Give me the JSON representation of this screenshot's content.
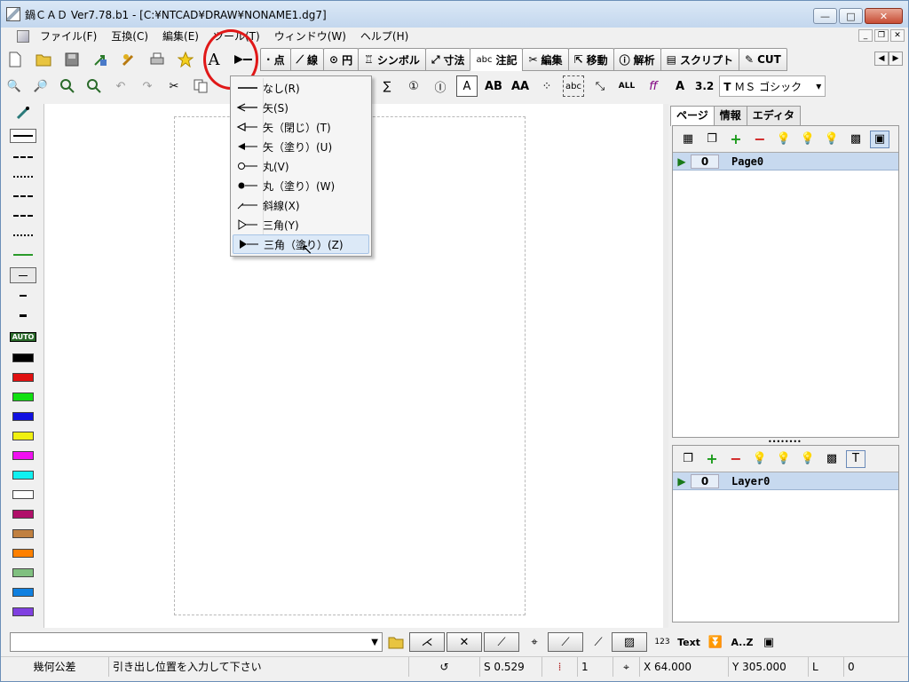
{
  "window": {
    "title": "鍋ＣＡＤ Ver7.78.b1 - [C:¥NTCAD¥DRAW¥NONAME1.dg7]",
    "minimize": "—",
    "maximize": "□",
    "close": "✕",
    "mdi_min": "_",
    "mdi_restore": "❐",
    "mdi_close": "✕"
  },
  "menu": {
    "items": [
      "ファイル(F)",
      "互換(C)",
      "編集(E)",
      "ツール(T)",
      "ウィンドウ(W)",
      "ヘルプ(H)"
    ]
  },
  "command_tabs": [
    {
      "icon": "·",
      "label": "点"
    },
    {
      "icon": "⟋",
      "label": "線"
    },
    {
      "icon": "⊙",
      "label": "円"
    },
    {
      "icon": "♖",
      "label": "シンボル"
    },
    {
      "icon": "⤢",
      "label": "寸法"
    },
    {
      "icon": "abc",
      "label": "注記"
    },
    {
      "icon": "✂",
      "label": "編集"
    },
    {
      "icon": "⇱",
      "label": "移動"
    },
    {
      "icon": "ⓘ",
      "label": "解析"
    },
    {
      "icon": "▤",
      "label": "スクリプト"
    },
    {
      "icon": "✎",
      "label": "CUT"
    }
  ],
  "toolbar2": {
    "font_size": "3.2",
    "font_name": "ＭＳ ゴシック",
    "font_prefix": "T"
  },
  "arrow_menu": {
    "items": [
      {
        "icon": "none",
        "label": "なし(R)"
      },
      {
        "icon": "arrow-open",
        "label": "矢(S)"
      },
      {
        "icon": "arrow-closed",
        "label": "矢（閉じ）(T)"
      },
      {
        "icon": "arrow-filled",
        "label": "矢（塗り）(U)"
      },
      {
        "icon": "circle-open",
        "label": "丸(V)"
      },
      {
        "icon": "circle-filled",
        "label": "丸（塗り）(W)"
      },
      {
        "icon": "slash",
        "label": "斜線(X)"
      },
      {
        "icon": "triangle-open",
        "label": "三角(Y)"
      },
      {
        "icon": "triangle-filled",
        "label": "三角（塗り）(Z)"
      }
    ],
    "highlighted_index": 8
  },
  "palette": {
    "auto_label": "AUTO",
    "colors": [
      "#000000",
      "#e01010",
      "#10e010",
      "#1010e0",
      "#f0f010",
      "#f010f0",
      "#10f0f0",
      "#ffffff",
      "#b0106a",
      "#c08040",
      "#ff8000",
      "#80c080",
      "#1080e0",
      "#8040e0"
    ]
  },
  "right_panel": {
    "tabs": [
      "ページ",
      "情報",
      "エディタ"
    ],
    "pages": [
      {
        "num": "0",
        "name": "Page0"
      }
    ],
    "layers": [
      {
        "num": "0",
        "name": "Layer0"
      }
    ]
  },
  "bottom_toolbar": {
    "text_btn": "Text",
    "az_btn": "A..Z",
    "num_btn": "123"
  },
  "status": {
    "mode": "幾何公差",
    "message": "引き出し位置を入力して下さい",
    "scale": "S 0.529",
    "grid": "1",
    "x": "X 64.000",
    "y": "Y 305.000",
    "l_label": "L",
    "l_value": "0"
  }
}
